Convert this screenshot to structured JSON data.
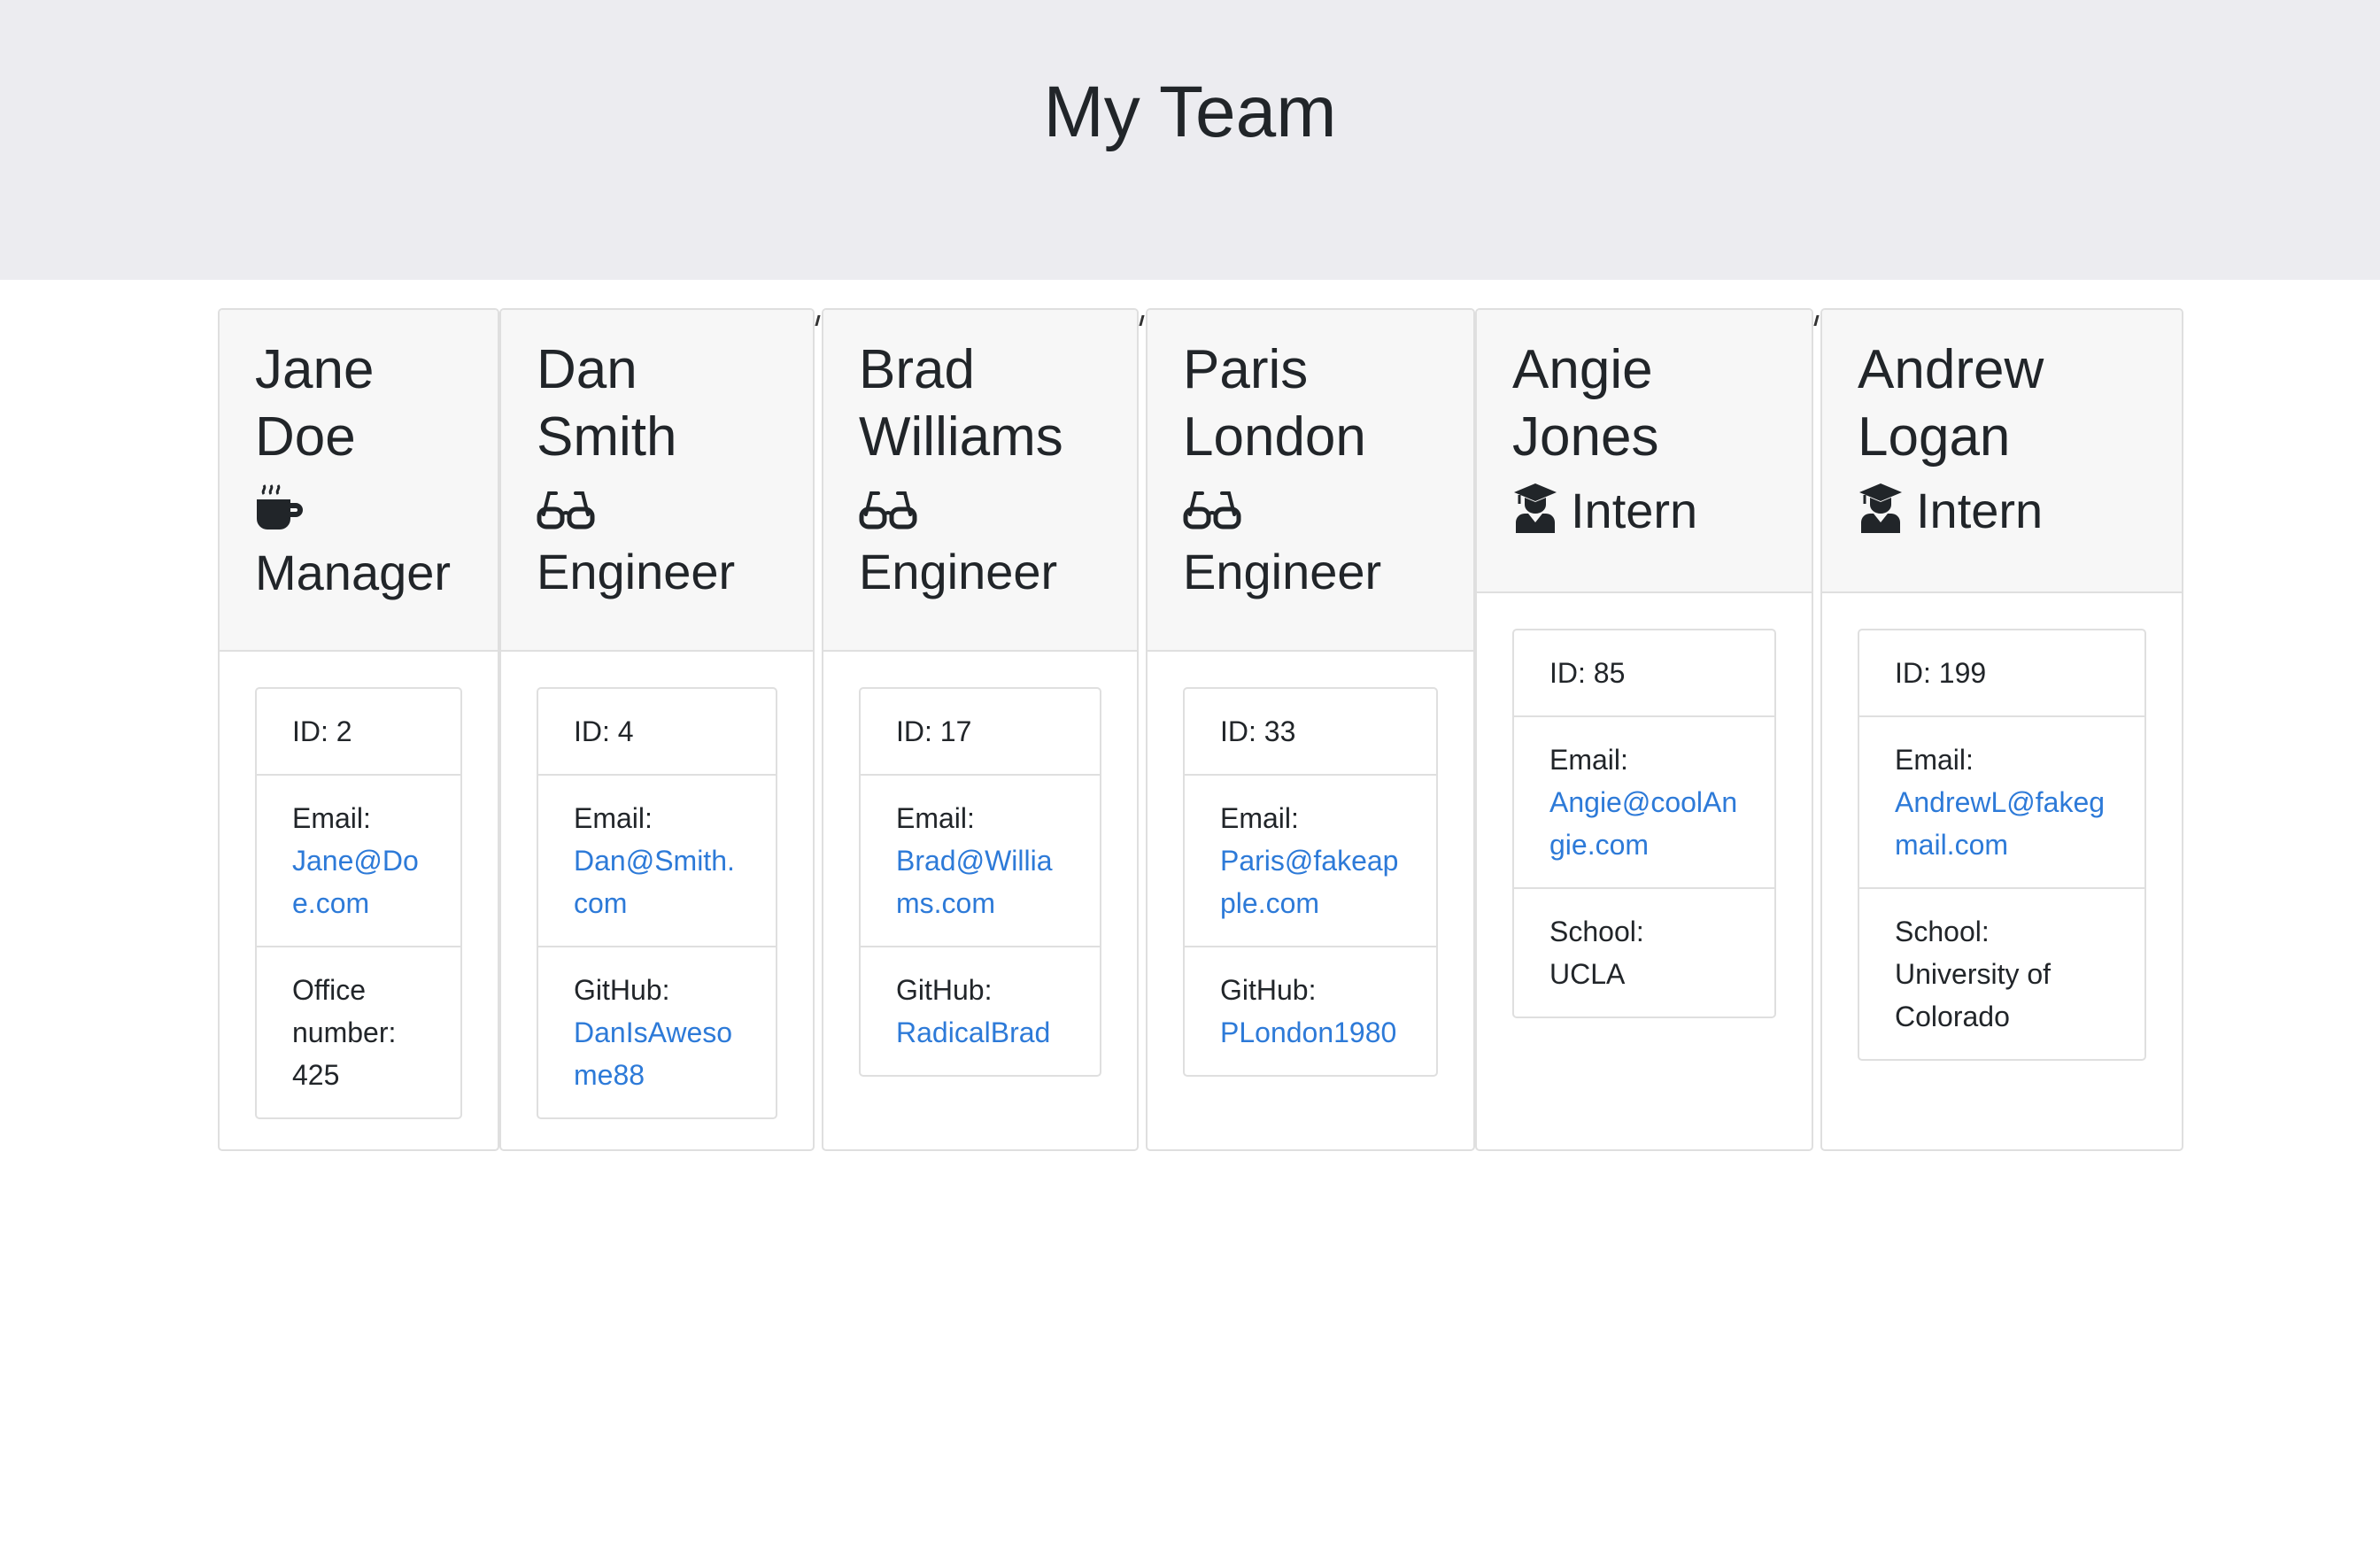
{
  "page": {
    "title": "My Team"
  },
  "team": [
    {
      "name": "Jane Doe",
      "role": "Manager",
      "icon": "coffee-icon",
      "id_text": "ID: 2",
      "email_label": "Email:",
      "email": "Jane@Doe.com",
      "extra_label": "Office number:",
      "extra_value": "425",
      "extra_is_link": false
    },
    {
      "name": "Dan Smith",
      "role": "Engineer",
      "icon": "glasses-icon",
      "id_text": "ID: 4",
      "email_label": "Email:",
      "email": "Dan@Smith.com",
      "extra_label": "GitHub:",
      "extra_value": "DanIsAwesome88",
      "extra_is_link": true
    },
    {
      "name": "Brad Williams",
      "role": "Engineer",
      "icon": "glasses-icon",
      "id_text": "ID: 17",
      "email_label": "Email:",
      "email": "Brad@Williams.com",
      "extra_label": "GitHub:",
      "extra_value": "RadicalBrad",
      "extra_is_link": true
    },
    {
      "name": "Paris London",
      "role": "Engineer",
      "icon": "glasses-icon",
      "id_text": "ID: 33",
      "email_label": "Email:",
      "email": "Paris@fakeapple.com",
      "extra_label": "GitHub:",
      "extra_value": "PLondon1980",
      "extra_is_link": true
    },
    {
      "name": "Angie Jones",
      "role": "Intern",
      "icon": "graduate-icon",
      "id_text": "ID: 85",
      "email_label": "Email:",
      "email": "Angie@coolAngie.com",
      "extra_label": "School:",
      "extra_value": "UCLA",
      "extra_is_link": false
    },
    {
      "name": "Andrew Logan",
      "role": "Intern",
      "icon": "graduate-icon",
      "id_text": "ID: 199",
      "email_label": "Email:",
      "email": "AndrewL@fakegmail.com",
      "extra_label": "School:",
      "extra_value": "University of Colorado",
      "extra_is_link": false
    }
  ]
}
